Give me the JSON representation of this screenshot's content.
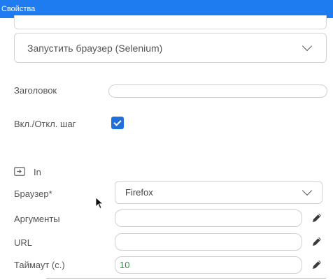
{
  "window": {
    "title": "Свойства"
  },
  "action_select": {
    "value": "Запустить браузер (Selenium)",
    "icon": "chevron-down-icon"
  },
  "fields": {
    "title_label": "Заголовок",
    "title_value": "",
    "toggle_label": "Вкл./Откл. шаг",
    "toggle_checked": true
  },
  "section": {
    "label": "In",
    "icon": "input-arrow-icon"
  },
  "params": {
    "browser_label": "Браузер*",
    "browser_value": "Firefox",
    "args_label": "Аргументы",
    "args_value": "",
    "url_label": "URL",
    "url_value": "",
    "timeout_label": "Таймаут (с.)",
    "timeout_value": "10",
    "edit_icon": "pencil-icon"
  },
  "colors": {
    "titlebar": "#1f7bf0",
    "checkbox": "#1f6fdc",
    "value_green": "#2f8f4f"
  }
}
